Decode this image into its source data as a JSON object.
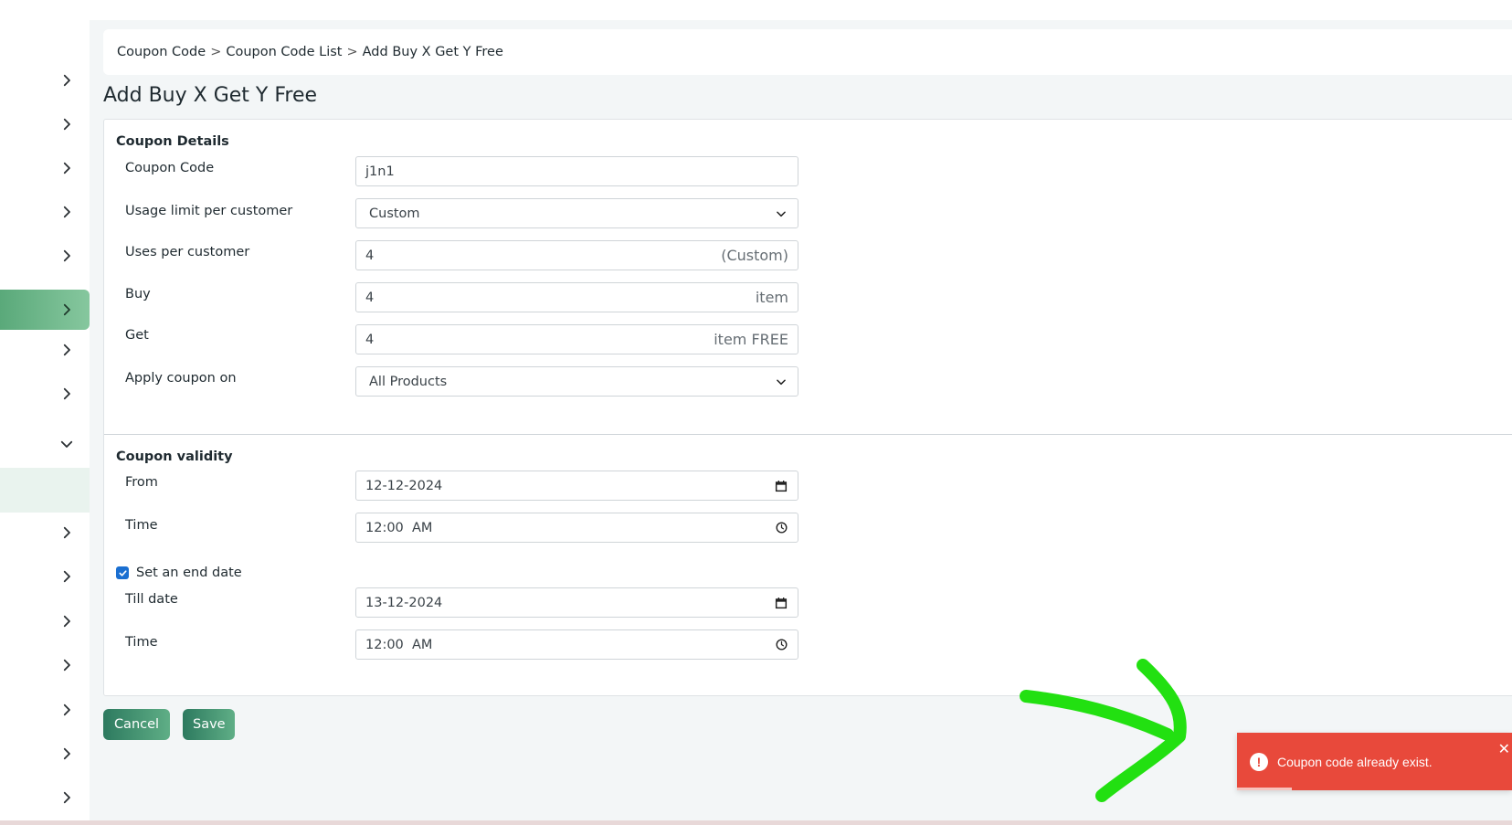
{
  "breadcrumb": [
    {
      "label": "Coupon Code"
    },
    {
      "label": "Coupon Code List"
    },
    {
      "label": "Add Buy X Get Y Free"
    }
  ],
  "breadcrumb_separator": ">",
  "page_title": "Add Buy X Get Y Free",
  "coupon_details": {
    "title": "Coupon Details",
    "coupon_code": {
      "label": "Coupon Code",
      "value": "j1n1"
    },
    "usage_limit": {
      "label": "Usage limit per customer",
      "value": "Custom"
    },
    "uses_per_customer": {
      "label": "Uses per customer",
      "value": "4",
      "suffix": "(Custom)"
    },
    "buy": {
      "label": "Buy",
      "value": "4",
      "suffix": "item"
    },
    "get": {
      "label": "Get",
      "value": "4",
      "suffix": "item FREE"
    },
    "apply_on": {
      "label": "Apply coupon on",
      "value": "All Products"
    }
  },
  "coupon_validity": {
    "title": "Coupon validity",
    "from": {
      "label": "From",
      "value": "12-12-2024"
    },
    "from_time": {
      "label": "Time",
      "value": "12:00  AM"
    },
    "end_date_checkbox": {
      "label": "Set an end date",
      "checked": true
    },
    "till_date": {
      "label": "Till date",
      "value": "13-12-2024"
    },
    "till_time": {
      "label": "Time",
      "value": "12:00  AM"
    }
  },
  "buttons": {
    "cancel": "Cancel",
    "save": "Save"
  },
  "toast": {
    "icon": "!",
    "message": "Coupon code already exist.",
    "close": "✕",
    "progress": 0.2
  },
  "icons": {
    "sidebar": "chevron-right-icon",
    "sidebar_expanded": "chevron-down-icon",
    "select": "chevron-down-icon",
    "date": "calendar-icon",
    "time": "clock-icon"
  },
  "colors": {
    "accent": "#5aa97a",
    "button_gradient_start": "#2d7a5f",
    "button_gradient_end": "#5fae86",
    "toast_bg": "#e8493b",
    "checkbox": "#1a6fd1",
    "annotation_arrow": "#22e011"
  }
}
